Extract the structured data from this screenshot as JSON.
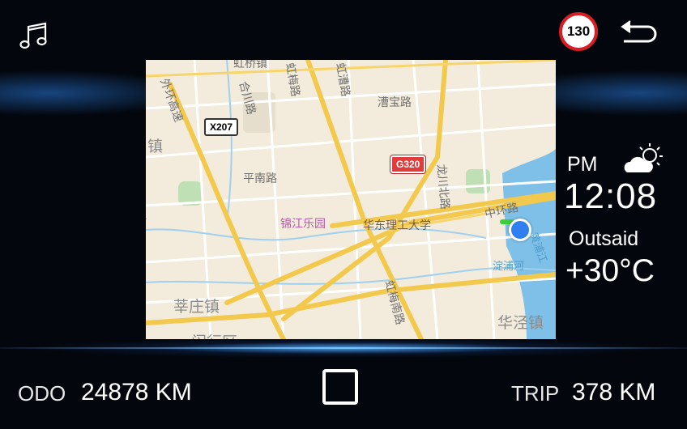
{
  "header": {
    "music_icon": "music-note-icon",
    "speed_limit": "130",
    "back_icon": "back-arrow-icon",
    "colors": {
      "speed_ring": "#d81e25",
      "accent_glow": "#50aaff"
    }
  },
  "map": {
    "labels": {
      "ring_road_west": "外环高速",
      "hongmei_rd": "虹梅路",
      "hongcao_rd": "虹漕路",
      "heyi_rd": "合川路",
      "caobao_rd": "漕宝路",
      "pingnan_rd": "平南路",
      "longchuan_n_rd": "龙川北路",
      "middle_ring_rd": "中环路",
      "jinjiang_park": "锦江乐园",
      "ecust": "华东理工大学",
      "dianpu_river": "淀浦河",
      "xinzhuang_town": "莘庄镇",
      "huajing_town": "华泾镇",
      "hongmei_s_rd": "虹梅南路",
      "huangpu_river": "黄浦江",
      "zhen_left": "镇",
      "zhen_left2": "镇",
      "town_top": "虹桥镇",
      "minhang_partial": "闵行区"
    },
    "shields": {
      "x207": "X207",
      "g320": "G320"
    },
    "current_location": "location-dot"
  },
  "status": {
    "period": "PM",
    "time": "12:08",
    "outside_label": "Outsaid",
    "temperature": "+30°C",
    "weather_icon": "partly-sunny-icon"
  },
  "footer": {
    "odo_label": "ODO",
    "odo_value": "24878 KM",
    "trip_label": "TRIP",
    "trip_value": "378 KM",
    "home_icon": "square-home-icon"
  }
}
